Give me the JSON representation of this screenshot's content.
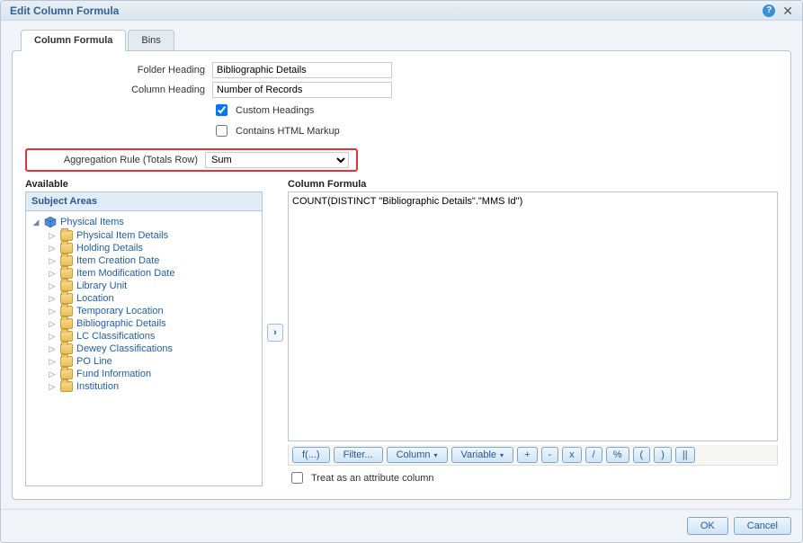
{
  "dialog": {
    "title": "Edit Column Formula",
    "help": "?",
    "close": "✕"
  },
  "tabs": {
    "column_formula": "Column Formula",
    "bins": "Bins"
  },
  "form": {
    "folder_heading_label": "Folder Heading",
    "folder_heading_value": "Bibliographic Details",
    "column_heading_label": "Column Heading",
    "column_heading_value": "Number of Records",
    "custom_headings": "Custom Headings",
    "html_markup": "Contains HTML Markup",
    "agg_label": "Aggregation Rule (Totals Row)",
    "agg_value": "Sum"
  },
  "left": {
    "available": "Available",
    "subject_areas": "Subject Areas",
    "root": "Physical Items",
    "items": [
      "Physical Item Details",
      "Holding Details",
      "Item Creation Date",
      "Item Modification Date",
      "Library Unit",
      "Location",
      "Temporary Location",
      "Bibliographic Details",
      "LC Classifications",
      "Dewey Classifications",
      "PO Line",
      "Fund Information",
      "Institution"
    ]
  },
  "formula": {
    "header": "Column Formula",
    "text": "COUNT(DISTINCT \"Bibliographic Details\".\"MMS Id\")",
    "attr_label": "Treat as an attribute column"
  },
  "toolbar": {
    "fx": "f(...)",
    "filter": "Filter...",
    "column": "Column",
    "variable": "Variable",
    "plus": "+",
    "minus": "-",
    "mult": "x",
    "div": "/",
    "pct": "%",
    "lparen": "(",
    "rparen": ")",
    "concat": "||"
  },
  "footer": {
    "ok": "OK",
    "cancel": "Cancel"
  }
}
